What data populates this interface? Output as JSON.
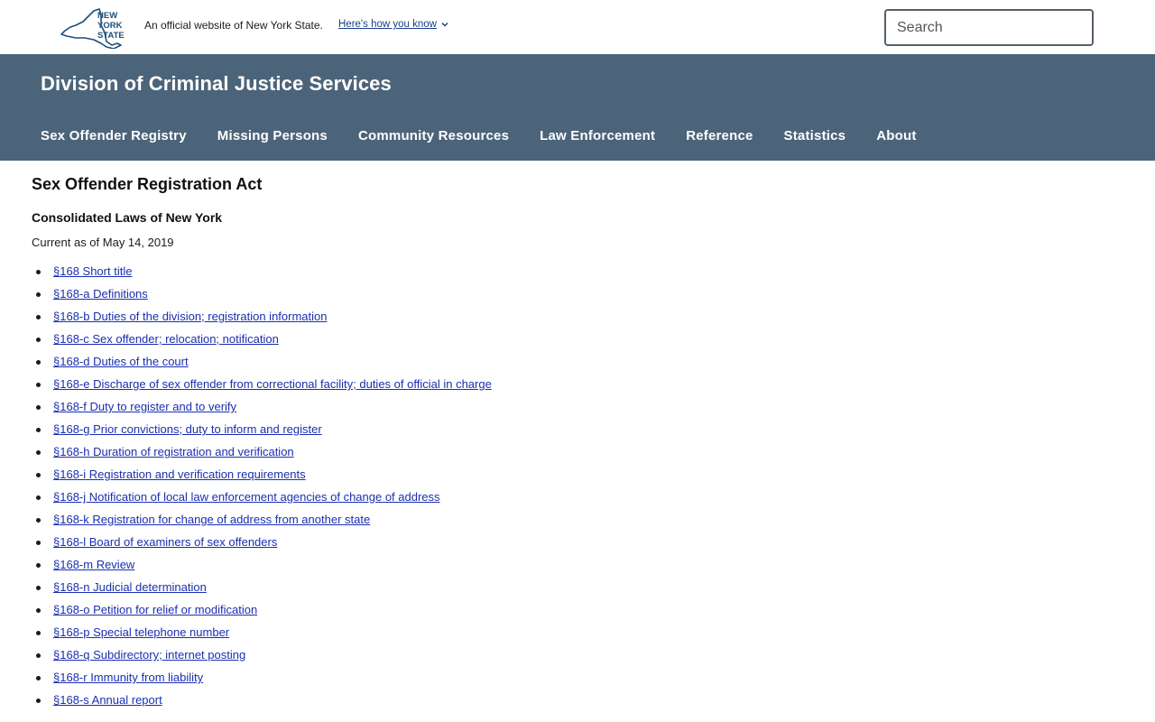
{
  "banner": {
    "logo_lines": [
      "NEW",
      "YORK",
      "STATE"
    ],
    "official_text": "An official website of New York State.",
    "how_know": "Here's how you know"
  },
  "search": {
    "placeholder": "Search"
  },
  "agency": {
    "title": "Division of Criminal Justice Services"
  },
  "nav": {
    "items": [
      {
        "label": "Sex Offender Registry"
      },
      {
        "label": "Missing Persons"
      },
      {
        "label": "Community Resources"
      },
      {
        "label": "Law Enforcement"
      },
      {
        "label": "Reference"
      },
      {
        "label": "Statistics"
      },
      {
        "label": "About"
      }
    ]
  },
  "content": {
    "title": "Sex Offender Registration Act",
    "subhead": "Consolidated Laws of New York",
    "current": "Current as of May 14, 2019",
    "sections": [
      "§168 Short title",
      "§168-a Definitions",
      "§168-b Duties of the division; registration information",
      "§168-c Sex offender; relocation; notification",
      "§168-d Duties of the court",
      "§168-e Discharge of sex offender from correctional facility; duties of official in charge",
      "§168-f Duty to register and to verify",
      "§168-g Prior convictions; duty to inform and register",
      "§168-h Duration of registration and verification",
      "§168-i Registration and verification requirements",
      "§168-j Notification of local law enforcement agencies of change of address",
      "§168-k Registration for change of address from another state",
      "§168-l Board of examiners of sex offenders",
      "§168-m Review",
      "§168-n Judicial determination",
      "§168-o Petition for relief or modification",
      "§168-p Special telephone number",
      "§168-q Subdirectory; internet posting",
      "§168-r Immunity from liability",
      "§168-s Annual report"
    ]
  },
  "colors": {
    "agency_bar": "#4c6479",
    "search_button": "#154973",
    "link": "#1a2fb0"
  }
}
